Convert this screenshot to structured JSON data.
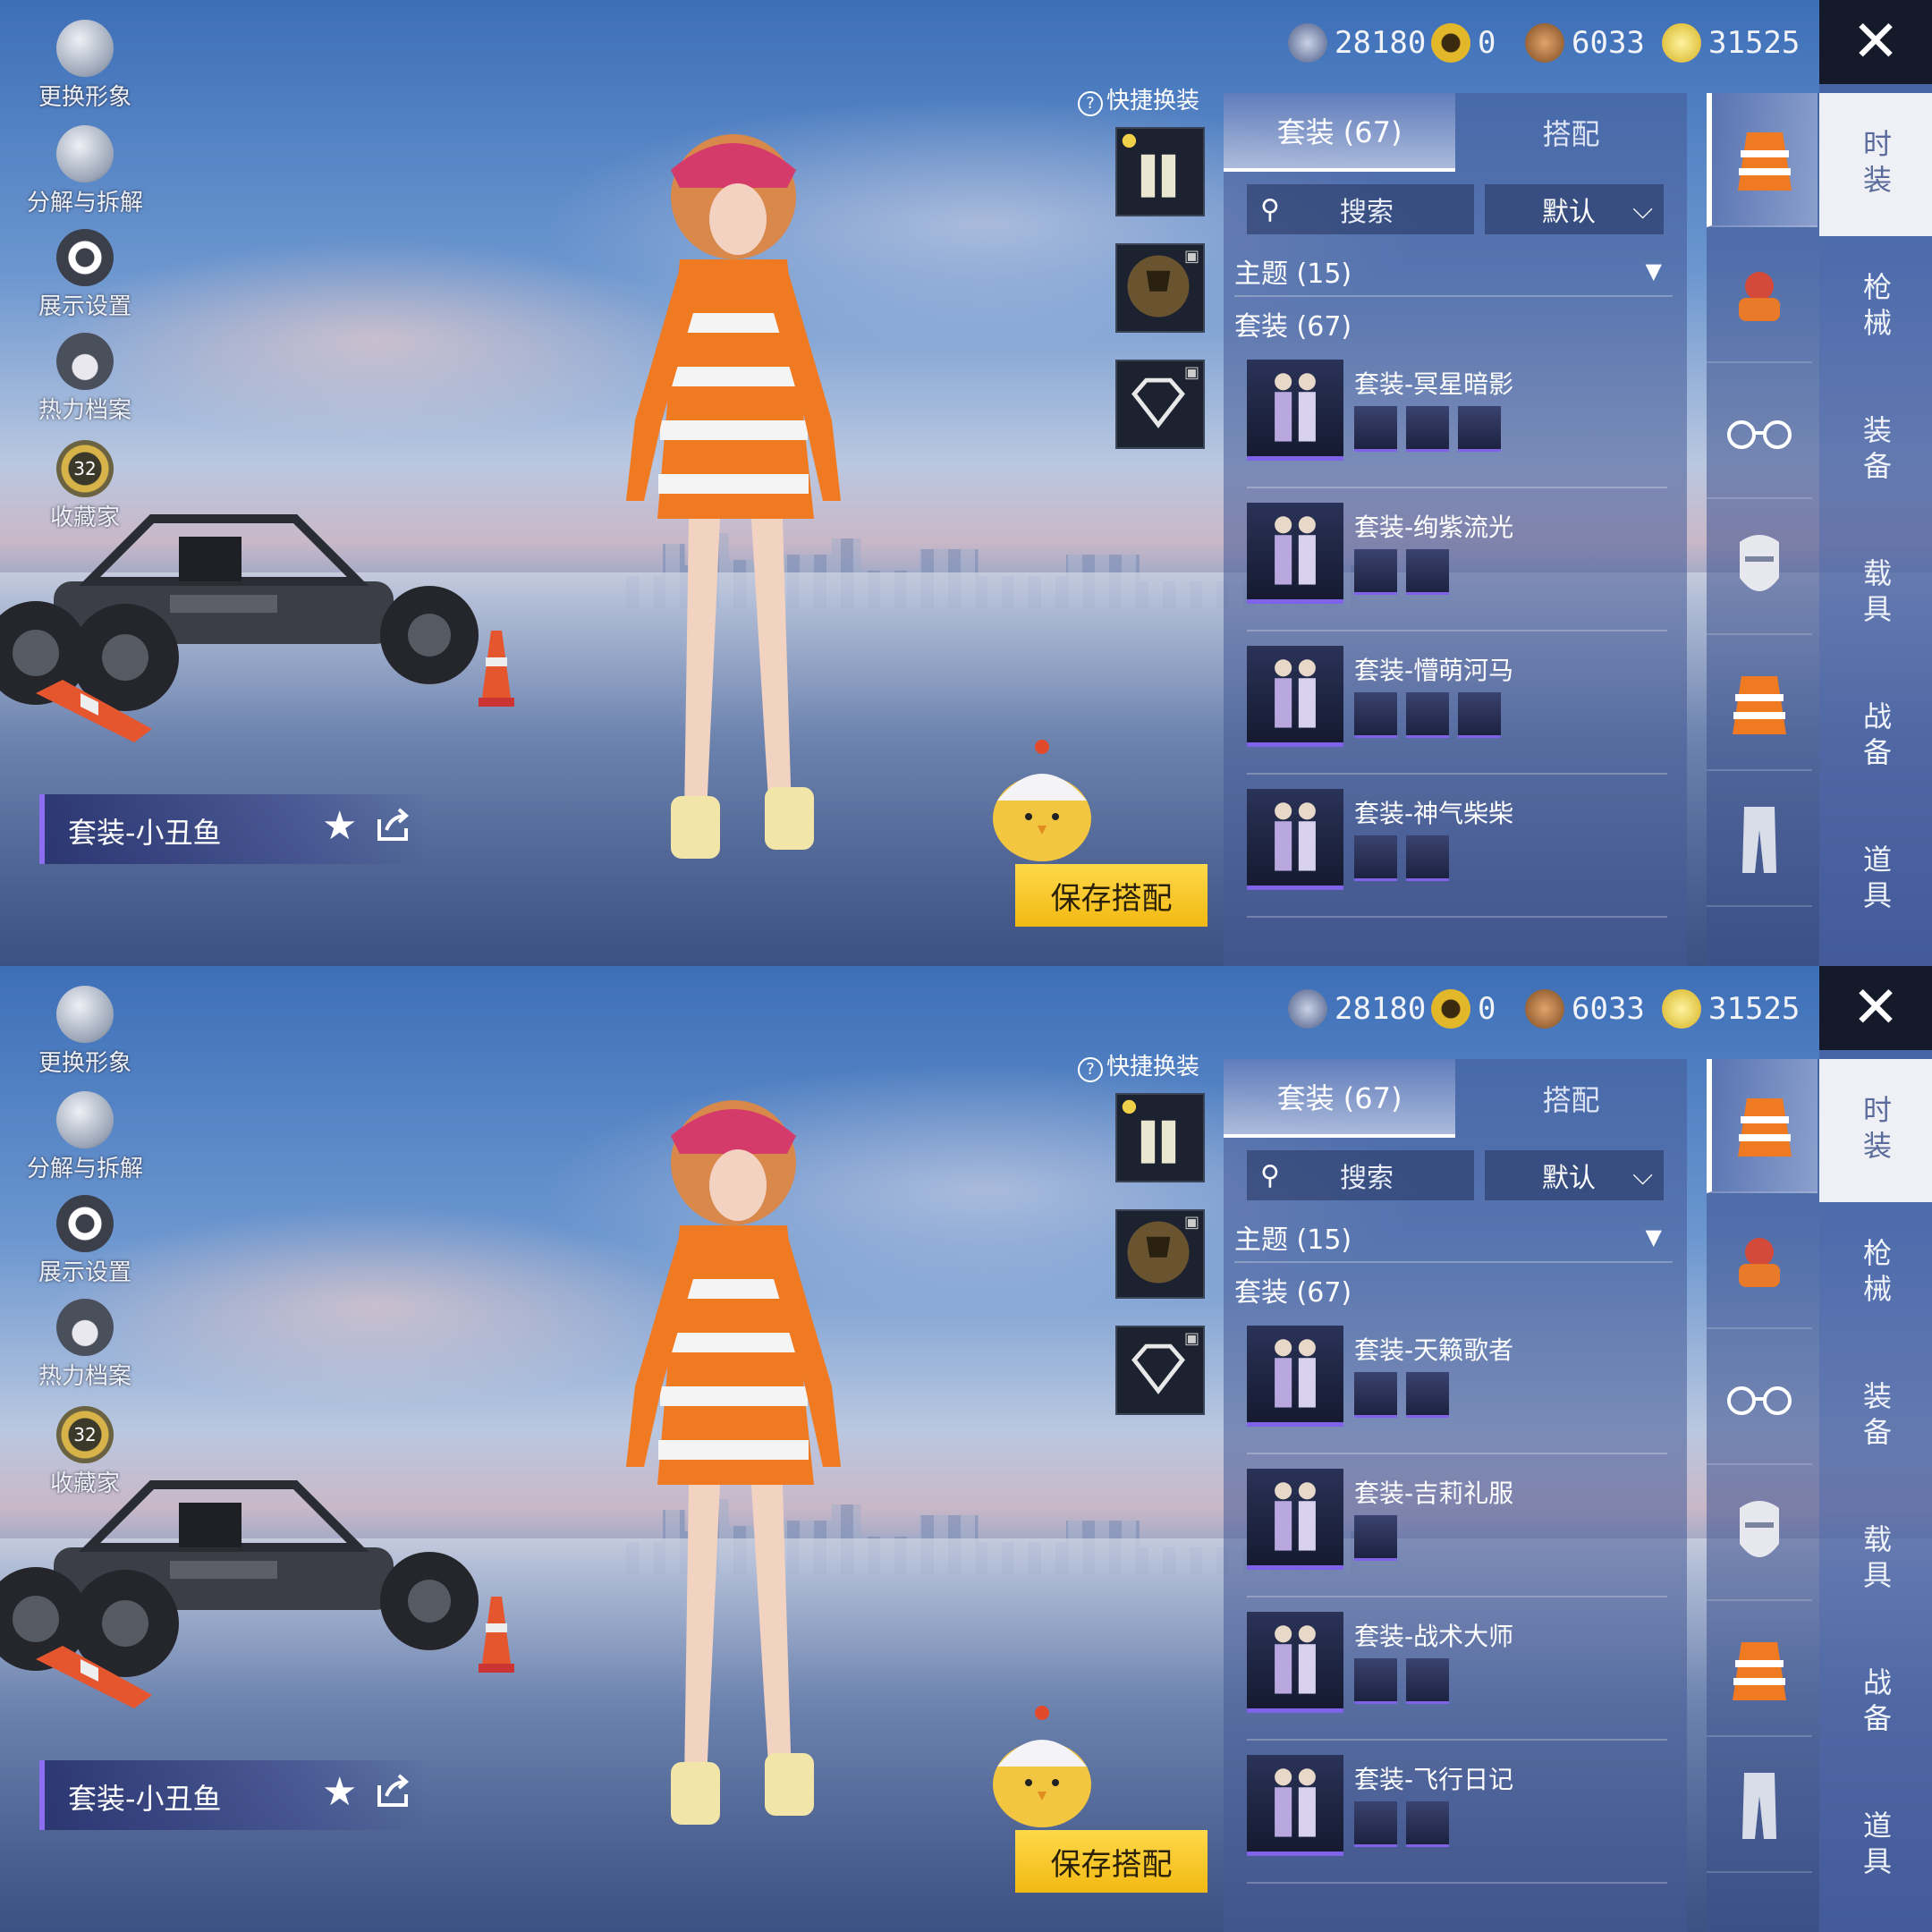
{
  "panels": [
    {
      "left_menu": [
        "更换形象",
        "分解与拆解",
        "展示设置",
        "热力档案",
        "收藏家"
      ],
      "collector_level": "32",
      "outfit_name": "套装-小丑鱼",
      "currency": [
        "28180",
        "0",
        "6033",
        "31525"
      ],
      "quick_change": "快捷换装",
      "save_button": "保存搭配",
      "tabs": [
        "套装 (67)",
        "搭配"
      ],
      "search_placeholder": "搜索",
      "sort": "默认",
      "theme": "主题 (15)",
      "suit_count": "套装 (67)",
      "items": [
        {
          "name": "套装-冥星暗影",
          "subs": 3
        },
        {
          "name": "套装-绚紫流光",
          "subs": 2
        },
        {
          "name": "套装-懵萌河马",
          "subs": 3
        },
        {
          "name": "套装-神气柴柴",
          "subs": 2
        }
      ],
      "main_categories": [
        "时装",
        "枪械",
        "装备",
        "载具",
        "战备",
        "道具"
      ]
    },
    {
      "left_menu": [
        "更换形象",
        "分解与拆解",
        "展示设置",
        "热力档案",
        "收藏家"
      ],
      "collector_level": "32",
      "outfit_name": "套装-小丑鱼",
      "currency": [
        "28180",
        "0",
        "6033",
        "31525"
      ],
      "quick_change": "快捷换装",
      "save_button": "保存搭配",
      "tabs": [
        "套装 (67)",
        "搭配"
      ],
      "search_placeholder": "搜索",
      "sort": "默认",
      "theme": "主题 (15)",
      "suit_count": "套装 (67)",
      "items": [
        {
          "name": "套装-天籁歌者",
          "subs": 2
        },
        {
          "name": "套装-吉莉礼服",
          "subs": 1
        },
        {
          "name": "套装-战术大师",
          "subs": 2
        },
        {
          "name": "套装-飞行日记",
          "subs": 2
        }
      ],
      "main_categories": [
        "时装",
        "枪械",
        "装备",
        "载具",
        "战备",
        "道具"
      ]
    }
  ],
  "colors": {
    "accent": "#7f62e8",
    "save": "#f2b913",
    "outfit_orange": "#f07a22"
  },
  "icons": [
    "avatar-icon",
    "puzzle-icon",
    "eye-icon",
    "flame-icon",
    "collector-badge-icon",
    "star-icon",
    "share-icon",
    "close-icon",
    "search-icon",
    "chevron-down-icon",
    "help-icon",
    "lock-icon",
    "trophy-icon",
    "diamond-icon",
    "outfit-icon",
    "backpack-icon",
    "glasses-icon",
    "mask-icon",
    "pants-icon"
  ]
}
